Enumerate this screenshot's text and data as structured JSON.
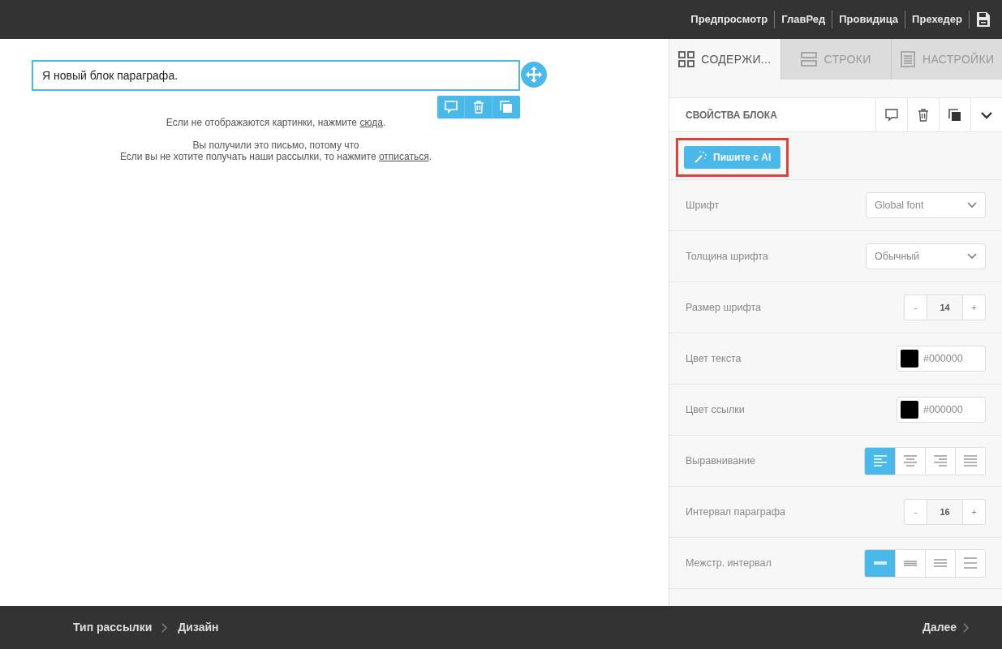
{
  "top_nav": {
    "links": [
      {
        "label": "Предпросмотр"
      },
      {
        "label": "ГлавРед"
      },
      {
        "label": "Провидица"
      },
      {
        "label": "Прехедер"
      }
    ]
  },
  "canvas": {
    "paragraph_block": {
      "text": "Я новый блок параграфа.",
      "selected": true
    },
    "footer_paragraphs": [
      {
        "lines": [
          {
            "before": "Если не отображаются картинки, нажмите ",
            "link": "сюда",
            "after": "."
          }
        ]
      },
      {
        "lines": [
          {
            "before": "Вы получили это письмо, потому что"
          },
          {
            "before": "Если вы не хотите получать наши рассылки, то нажмите ",
            "link": "отписаться",
            "after": "."
          }
        ]
      }
    ]
  },
  "sidebar": {
    "tabs": [
      {
        "label": "СОДЕРЖИ...",
        "selected": true
      },
      {
        "label": "СТРОКИ",
        "selected": false
      },
      {
        "label": "НАСТРОЙКИ",
        "selected": false
      }
    ],
    "block_header": {
      "title": "СВОЙСТВА БЛОКА"
    },
    "ai_button": {
      "label": "Пишите с AI",
      "highlighted": true
    },
    "properties": [
      {
        "kind": "select",
        "label": "Шрифт",
        "value": "Global font"
      },
      {
        "kind": "select",
        "label": "Толщина шрифта",
        "value": "Обычный"
      },
      {
        "kind": "stepper",
        "label": "Размер шрифта",
        "minus": "-",
        "value": "14",
        "plus": "+"
      },
      {
        "kind": "color",
        "label": "Цвет текста",
        "color": "#000000",
        "value": "#000000"
      },
      {
        "kind": "color",
        "label": "Цвет ссылки",
        "color": "#000000",
        "value": "#000000"
      },
      {
        "kind": "align",
        "label": "Выравнивание",
        "options": [
          {
            "selected": true
          },
          {
            "selected": false
          },
          {
            "selected": false
          },
          {
            "selected": false
          }
        ]
      },
      {
        "kind": "stepper",
        "label": "Интервал параграфа",
        "minus": "-",
        "value": "16",
        "plus": "+"
      },
      {
        "kind": "spacing",
        "label": "Межстр. интервал",
        "options": [
          {
            "selected": true
          },
          {
            "selected": false
          },
          {
            "selected": false
          },
          {
            "selected": false
          }
        ]
      }
    ]
  },
  "bottom_bar": {
    "steps": [
      {
        "label": "Тип рассылки"
      },
      {
        "label": "Дизайн"
      }
    ],
    "next": {
      "label": "Далее"
    }
  }
}
